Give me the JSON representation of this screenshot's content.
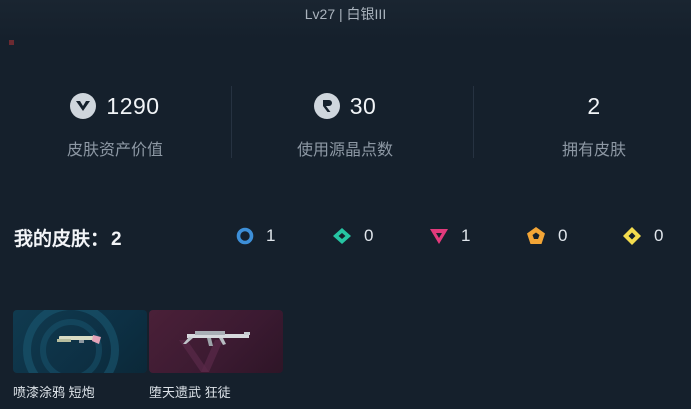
{
  "header": {
    "level_text": "Lv27 | 白银III"
  },
  "stats": [
    {
      "icon": "valorant-points-icon",
      "value": "1290",
      "label": "皮肤资产价值"
    },
    {
      "icon": "radianite-points-icon",
      "value": "30",
      "label": "使用源晶点数"
    },
    {
      "icon": "",
      "value": "2",
      "label": "拥有皮肤"
    }
  ],
  "skins": {
    "title": "我的皮肤：",
    "count": "2",
    "tiers": [
      {
        "icon": "select-tier-icon",
        "color": "#3d8fd8",
        "count": "1"
      },
      {
        "icon": "deluxe-tier-icon",
        "color": "#26c5a3",
        "count": "0"
      },
      {
        "icon": "premium-tier-icon",
        "color": "#e23a7c",
        "count": "1"
      },
      {
        "icon": "exclusive-tier-icon",
        "color": "#f3a536",
        "count": "0"
      },
      {
        "icon": "ultra-tier-icon",
        "color": "#f3dc4e",
        "count": "0"
      }
    ],
    "items": [
      {
        "name": "喷漆涂鸦 短炮",
        "tier": "select"
      },
      {
        "name": "堕天遗武 狂徒",
        "tier": "premium"
      }
    ]
  }
}
